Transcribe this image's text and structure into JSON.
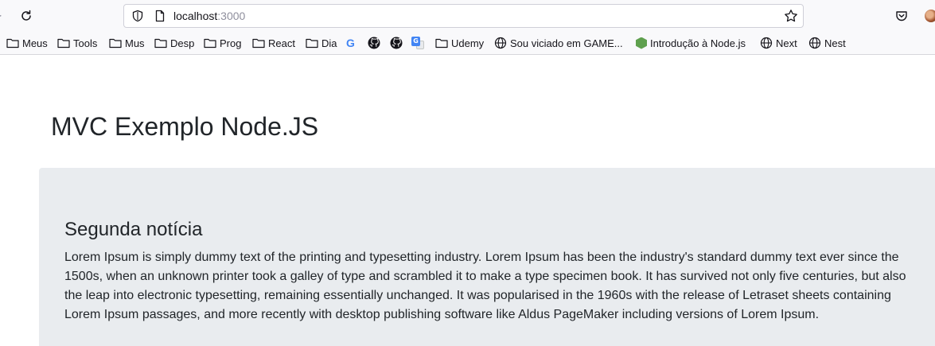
{
  "browser": {
    "url_host": "localhost",
    "url_port": ":3000",
    "bookmarks": [
      {
        "label": "Meus",
        "icon": "folder-icon"
      },
      {
        "label": "Tools",
        "icon": "folder-icon"
      },
      {
        "label": "Mus",
        "icon": "folder-icon"
      },
      {
        "label": "Desp",
        "icon": "folder-icon"
      },
      {
        "label": "Prog",
        "icon": "folder-icon"
      },
      {
        "label": "React",
        "icon": "folder-icon"
      },
      {
        "label": "Dia",
        "icon": "folder-icon"
      },
      {
        "label": "",
        "icon": "google-icon"
      },
      {
        "label": "",
        "icon": "github-icon"
      },
      {
        "label": "",
        "icon": "github-icon"
      },
      {
        "label": "",
        "icon": "google-translate-icon"
      },
      {
        "label": "Udemy",
        "icon": "folder-icon"
      },
      {
        "label": "Sou viciado em GAME...",
        "icon": "globe-icon"
      },
      {
        "label": "Introdução à Node.js",
        "icon": "nodejs-icon"
      },
      {
        "label": "Next",
        "icon": "globe-icon"
      },
      {
        "label": "Nest",
        "icon": "globe-icon"
      }
    ]
  },
  "page": {
    "title": "MVC Exemplo Node.JS",
    "news": {
      "title": "Segunda notícia",
      "body": "Lorem Ipsum is simply dummy text of the printing and typesetting industry. Lorem Ipsum has been the industry's standard dummy text ever since the 1500s, when an unknown printer took a galley of type and scrambled it to make a type specimen book. It has survived not only five centuries, but also the leap into electronic typesetting, remaining essentially unchanged. It was popularised in the 1960s with the release of Letraset sheets containing Lorem Ipsum passages, and more recently with desktop publishing software like Aldus PageMaker including versions of Lorem Ipsum."
    }
  },
  "colors": {
    "toolbar_bg": "#f9f9fb",
    "card_bg": "#e9ecef",
    "text": "#212529"
  }
}
